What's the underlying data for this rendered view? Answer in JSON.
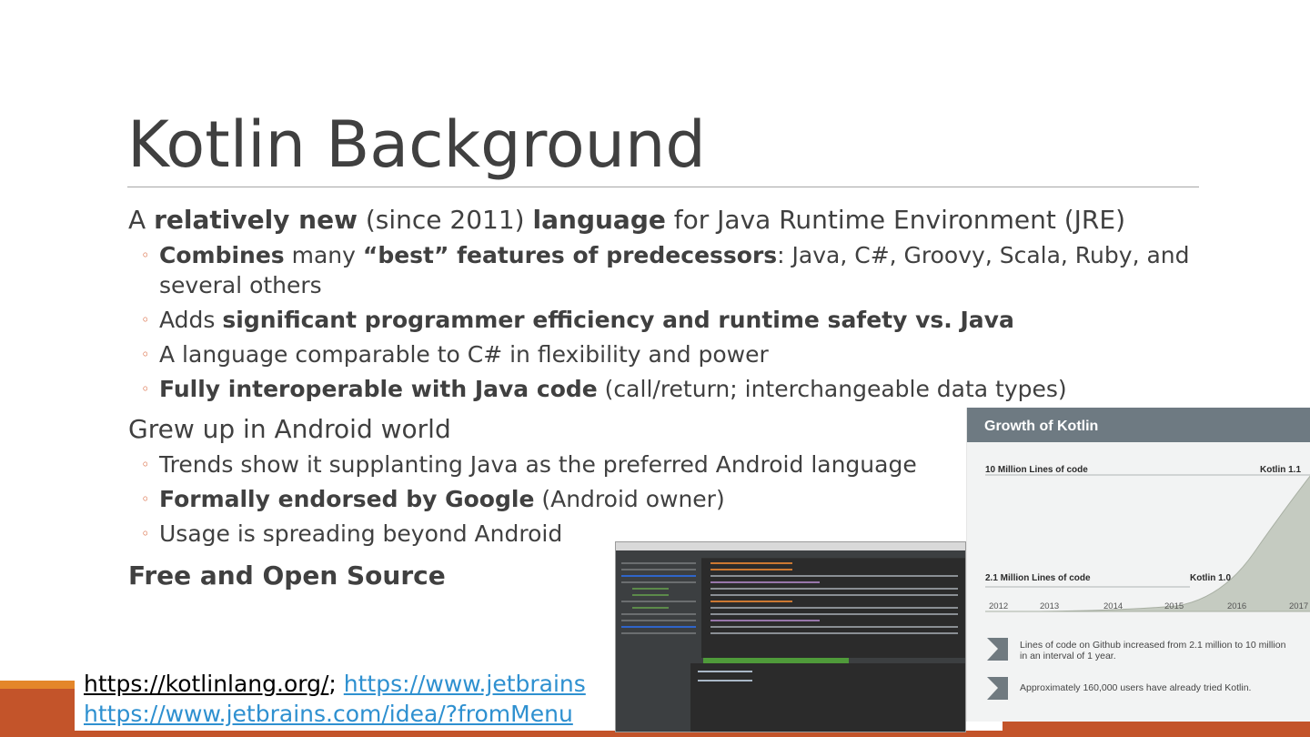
{
  "slide": {
    "title": "Kotlin Background"
  },
  "bullets": {
    "b1": {
      "p1": "A ",
      "p2": "relatively new",
      "p3": " (since 2011) ",
      "p4": "language",
      "p5": " for Java Runtime Environment (JRE)"
    },
    "b1_1": {
      "p1": "Combines",
      "p2": " many ",
      "p3": "“best” features of predecessors",
      "p4": ":  Java, C#, Groovy, Scala, Ruby, and several others"
    },
    "b1_2": {
      "p1": "Adds ",
      "p2": "significant programmer efficiency and runtime safety vs. Java"
    },
    "b1_3": {
      "p1": "A language comparable to C# in flexibility and power"
    },
    "b1_4": {
      "p1": "Fully interoperable with Java code",
      "p2": " (call/return; interchangeable data types)"
    },
    "b2": {
      "p1": "Grew up in Android world"
    },
    "b2_1": {
      "p1": "Trends show it supplanting Java as the preferred Android language"
    },
    "b2_2": {
      "p1": "Formally endorsed by Google",
      "p2": " (Android owner)"
    },
    "b2_3": {
      "p1": "Usage is spreading beyond Android"
    },
    "b3": {
      "p1": "Free and Open Source"
    }
  },
  "links": {
    "kotlin": "https://kotlinlang.org/",
    "sep": ";",
    "jetbrains_partial": "https://www.jetbrains",
    "idea_partial": "https://www.jetbrains.com/idea/?fromMenu"
  },
  "growth_graphic": {
    "header": "Growth of Kotlin",
    "top_label": "10 Million Lines of code",
    "top_version": "Kotlin 1.1",
    "bottom_label": "2.1 Million Lines of code",
    "bottom_version": "Kotlin 1.0",
    "years": [
      "2012",
      "2013",
      "2014",
      "2015",
      "2016",
      "2017"
    ],
    "note1": "Lines of code on Github increased from 2.1 million to 10 million in an interval of 1 year.",
    "note2": "Approximately 160,000 users have already tried Kotlin."
  },
  "colors": {
    "accent_dark": "#c3542a",
    "accent_light": "#e4862a",
    "bullet_mark": "#d5582b",
    "link": "#2e90d0",
    "graphic_header": "#6e7a82"
  }
}
